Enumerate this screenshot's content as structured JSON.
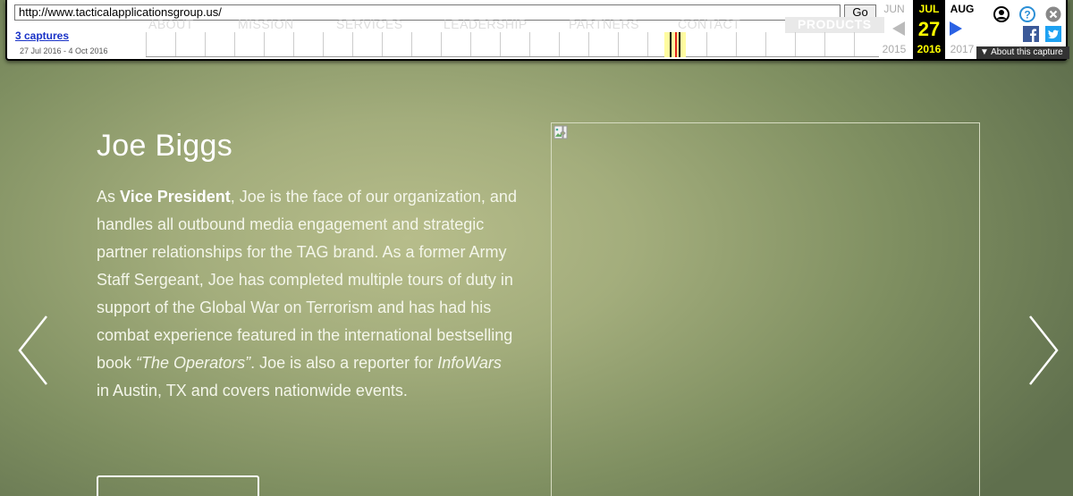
{
  "wayback": {
    "url": "http://www.tacticalapplicationsgroup.us/",
    "go_label": "Go",
    "captures_link": "3 captures",
    "capture_range": "27 Jul 2016 - 4 Oct 2016",
    "ghost_nav": [
      "ABOUT",
      "MISSION",
      "SERVICES",
      "LEADERSHIP",
      "PARTNERS",
      "CONTACT",
      "PRODUCTS"
    ],
    "prev_month": "JUN",
    "current_month": "JUL",
    "next_month": "AUG",
    "current_day": "27",
    "prev_year": "2015",
    "current_year": "2016",
    "next_year": "2017",
    "about_capture": "About this capture",
    "colors": {
      "current_highlight": "#000000",
      "current_text": "#ffff00",
      "link": "#1a33c7",
      "next_arrow": "#2b62e4"
    },
    "icons": [
      "account-icon",
      "help-icon",
      "close-icon",
      "facebook-icon",
      "twitter-icon"
    ]
  },
  "bio": {
    "name": "Joe Biggs",
    "intro_prefix": "As ",
    "title_bold": "Vice President",
    "body_1": ", Joe is the face of our organization, and handles all outbound media engagement and strategic partner relationships for the TAG brand. As a former Army Staff Sergeant, Joe has completed multiple tours of duty in support of the Global War on Terrorism and has had his combat experience featured in the international bestselling book ",
    "book_title": "“The Operators”",
    "body_2": ". Joe is also a reporter for ",
    "outlet": "InfoWars",
    "body_3": " in Austin, TX and covers nationwide events."
  },
  "carousel": {
    "prev_icon": "chevron-left-icon",
    "next_icon": "chevron-right-icon"
  }
}
